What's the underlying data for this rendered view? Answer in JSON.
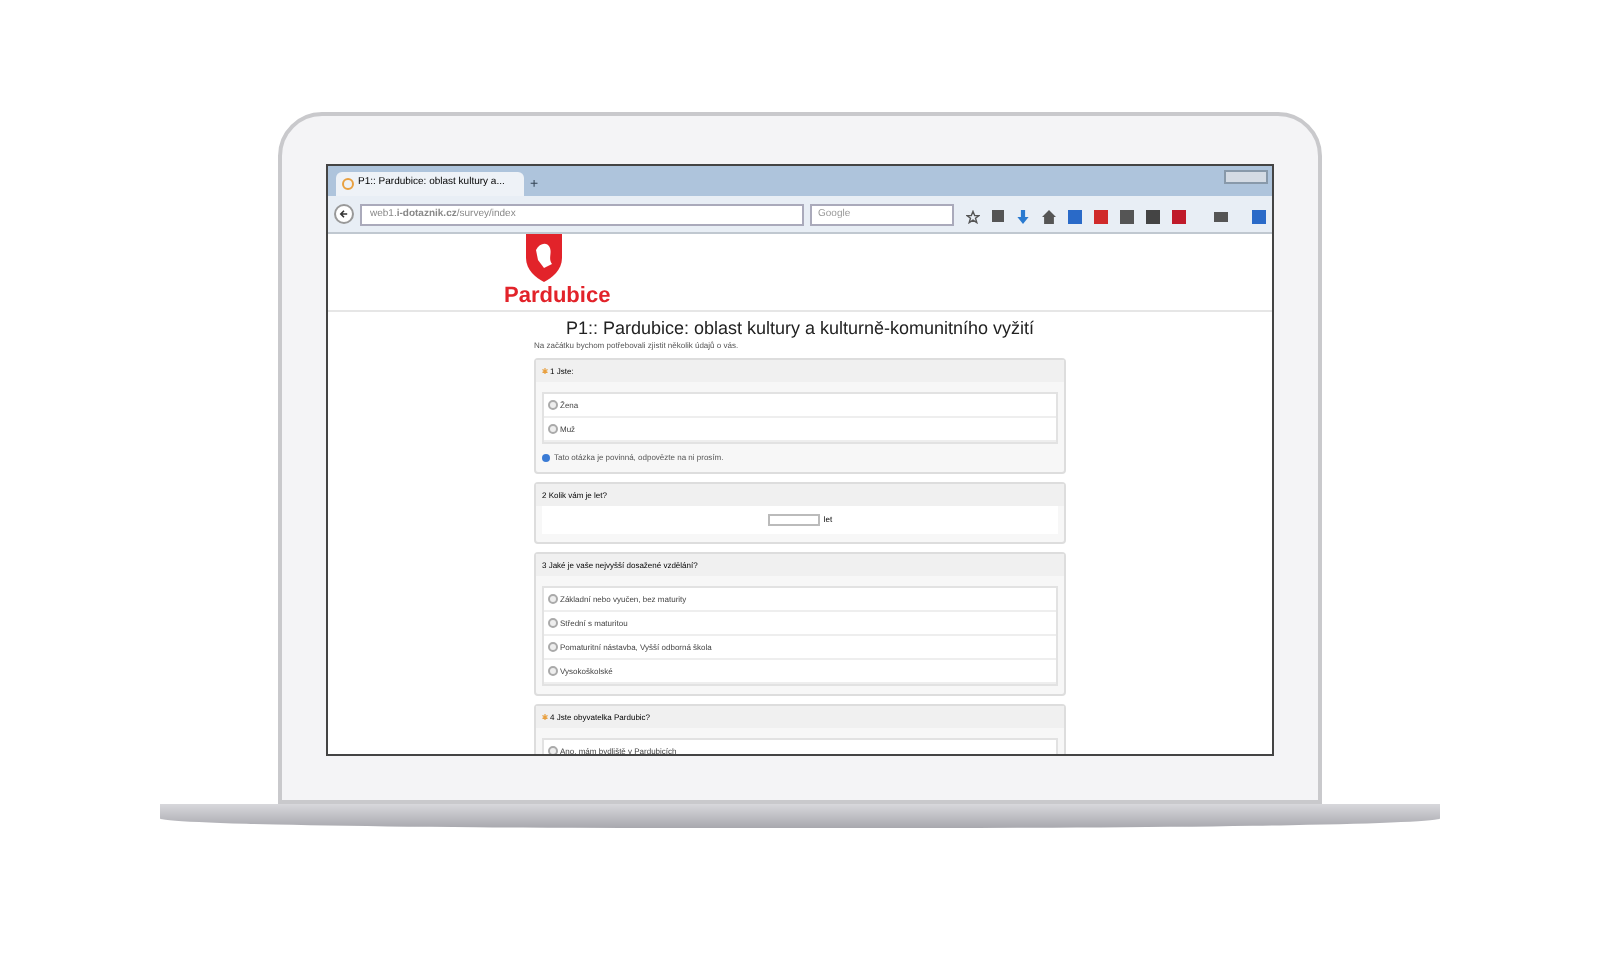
{
  "browser": {
    "tab_title": "P1:: Pardubice: oblast kultury a...",
    "new_tab": "+",
    "url": "web1.**i-dotaznik.cz**/survey/index",
    "search_placeholder": "Google"
  },
  "page": {
    "logo_text": "Pardubice",
    "title": "P1:: Pardubice: oblast kultury a kulturně-komunitního vyžití",
    "intro": "Na začátku bychom potřebovali zjistit několik údajů o vás."
  },
  "questions": [
    {
      "kind": "radio",
      "number": "1",
      "required": true,
      "text": "Jste:",
      "options": [
        {
          "label": "Žena",
          "selected": false
        },
        {
          "label": "Muž",
          "selected": false
        }
      ],
      "note": "Tato otázka je povinná, odpovězte na ni prosím."
    },
    {
      "kind": "number",
      "number": "2",
      "required": false,
      "text": "Kolik vám je let?",
      "unit": "let"
    },
    {
      "kind": "radio",
      "number": "3",
      "required": false,
      "text": "Jaké je vaše nejvyšší dosažené vzdělání?",
      "options": [
        {
          "label": "Základní nebo vyučen, bez maturity",
          "selected": false
        },
        {
          "label": "Střední s maturitou",
          "selected": false
        },
        {
          "label": "Pomaturitní nástavba, Vyšší odborná škola",
          "selected": false
        },
        {
          "label": "Vysokoškolské",
          "selected": false
        }
      ]
    },
    {
      "kind": "radio",
      "number": "4",
      "required": true,
      "text": "Jste obyvatelka Pardubic?",
      "options": [
        {
          "label": "Ano, mám bydliště v Pardubicích",
          "selected": false
        }
      ]
    }
  ]
}
